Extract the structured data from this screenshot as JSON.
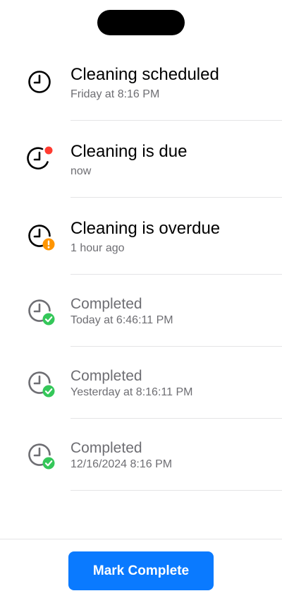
{
  "accent_color": "#0a7aff",
  "badge_colors": {
    "due": "#ff3b30",
    "overdue": "#ff9500",
    "completed": "#34c759"
  },
  "events": [
    {
      "state": "scheduled",
      "icon": "clock-icon",
      "title": "Cleaning scheduled",
      "subtitle": "Friday at 8:16 PM"
    },
    {
      "state": "due",
      "icon": "clock-due-icon",
      "title": "Cleaning is due",
      "subtitle": "now"
    },
    {
      "state": "overdue",
      "icon": "clock-overdue-icon",
      "title": "Cleaning is overdue",
      "subtitle": "1 hour ago"
    },
    {
      "state": "completed",
      "icon": "clock-completed-icon",
      "title": "Completed",
      "subtitle": "Today at 6:46:11 PM"
    },
    {
      "state": "completed",
      "icon": "clock-completed-icon",
      "title": "Completed",
      "subtitle": "Yesterday at 8:16:11 PM"
    },
    {
      "state": "completed",
      "icon": "clock-completed-icon",
      "title": "Completed",
      "subtitle": "12/16/2024 8:16 PM"
    }
  ],
  "actions": {
    "mark_complete_label": "Mark Complete"
  }
}
